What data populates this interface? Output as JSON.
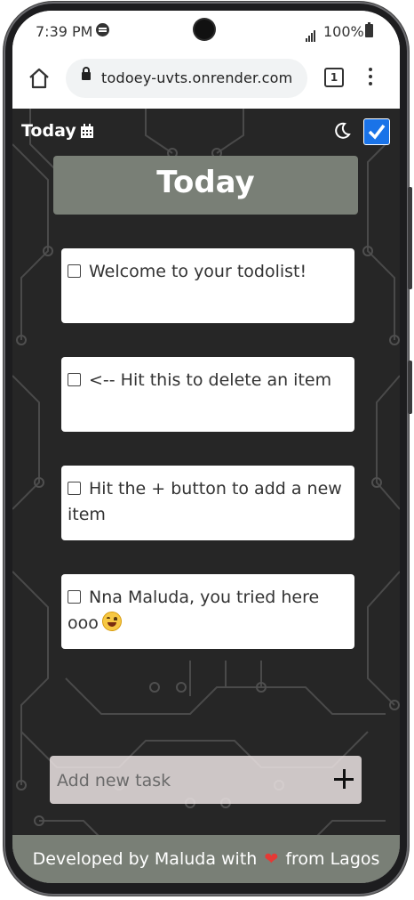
{
  "status_bar": {
    "time": "7:39 PM",
    "battery": "100%"
  },
  "browser": {
    "url": "todoey-uvts.onrender.com",
    "tab_count": "1"
  },
  "header": {
    "label": "Today"
  },
  "title": "Today",
  "todos": [
    {
      "text": "Welcome to your todolist!"
    },
    {
      "text": "<-- Hit this to delete an item"
    },
    {
      "text": "Hit the + button to add a new item"
    },
    {
      "text": "Nna Maluda, you tried here ooo"
    }
  ],
  "add_task": {
    "placeholder": "Add new task",
    "button": "+"
  },
  "footer": {
    "before": "Developed by Maluda with",
    "after": "from Lagos"
  },
  "colors": {
    "accent_card": "#797f76",
    "app_background": "#262626",
    "toggle": "#1a73e8",
    "heart": "#e53935"
  }
}
